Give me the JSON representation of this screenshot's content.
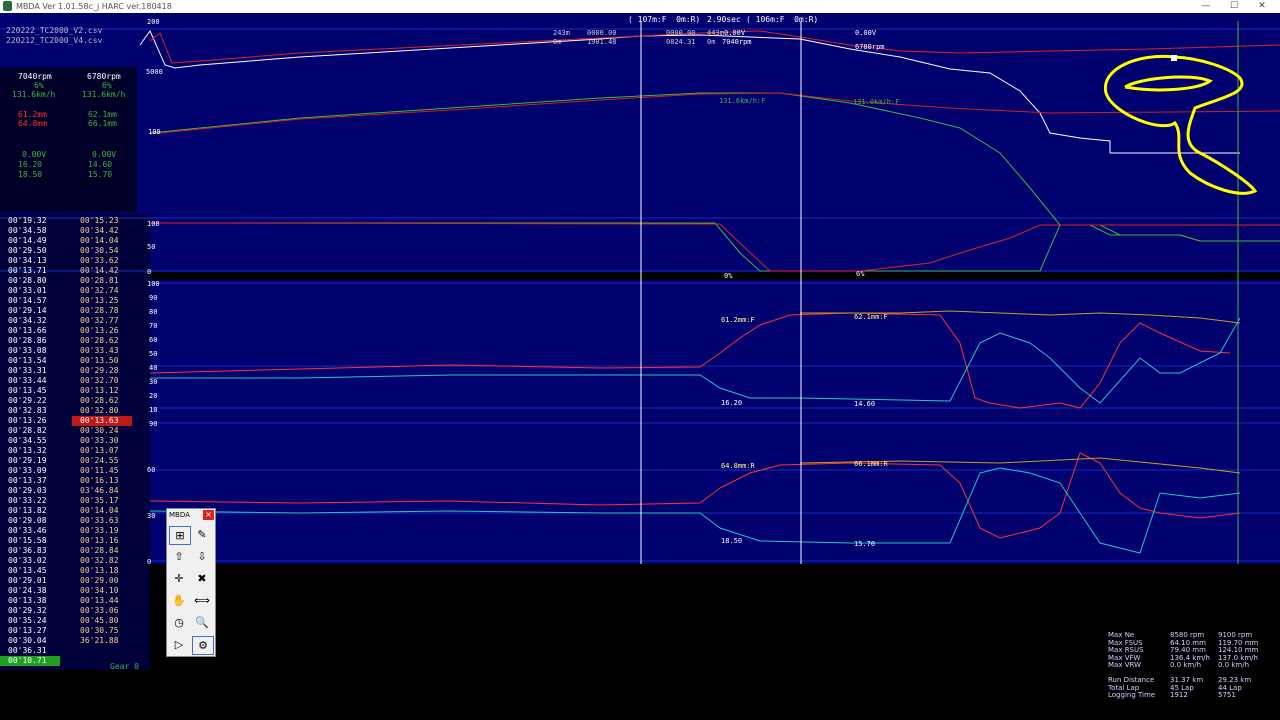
{
  "window": {
    "title": "MBDA Ver 1.01.58c_j HARC ver.180418",
    "min_icon": "—",
    "max_icon": "☐",
    "close_icon": "✕"
  },
  "files": [
    "220222_TC2000_V2.csv",
    "220212_TC2000_V4.csv"
  ],
  "top_info": {
    "range": "( 107m:F  0m:R)",
    "time": "2.90sec",
    "range2": "( 106m:F  0m:R)",
    "dist_a": "243m",
    "dist_b": "0m",
    "time_a": "0000.00",
    "time_b": "1901.48",
    "time_c": "0000.00",
    "time_d": "0824.31",
    "m_a": "443m",
    "m_b": "0m",
    "rpm_a": "7040rpm",
    "volt_a": "0.00V"
  },
  "left_readouts": {
    "col1": [
      "7040rpm",
      "6%",
      "131.6km/h",
      "61.2mm",
      "64.8mm",
      "0.00V",
      "16.20",
      "18.50"
    ],
    "col2": [
      "6780rpm",
      "6%",
      "131.6km/h",
      "62.1mm",
      "66.1mm",
      "0.00V",
      "14.60",
      "15.70"
    ]
  },
  "axis_labels": {
    "rpm_max": "200",
    "rpm_val": "5000",
    "speed": "100",
    "thr": "100",
    "thr_mid": "50",
    "thr_min": "0",
    "susp_ticks": [
      "100",
      "90",
      "80",
      "70",
      "60",
      "50",
      "40",
      "30",
      "20",
      "10"
    ],
    "susp2_ticks": [
      "90",
      "60",
      "30",
      "0"
    ]
  },
  "chart_labels": {
    "volt": "0.00V",
    "rpm": "6780rpm",
    "speed_a": "131.6km/h:F",
    "speed_b": "131.0km/h:F",
    "thr_a": "0%",
    "thr_b": "6%",
    "fs_a": "61.2mm:F",
    "fs_b": "62.1mm:F",
    "v1": "16.20",
    "v2": "14.60",
    "rs_a": "64.8mm:R",
    "rs_b": "66.1mm:R",
    "v3": "18.50",
    "v4": "15.70"
  },
  "lap_times": {
    "col1": [
      "00'19.32",
      "00'34.58",
      "00'14.49",
      "00'29.50",
      "00'34.13",
      "00'13.71",
      "00'28.80",
      "00'33.01",
      "00'14.57",
      "00'29.14",
      "00'34.32",
      "00'13.66",
      "00'28.86",
      "00'33.08",
      "00'13.54",
      "00'33.31",
      "00'33.44",
      "00'13.45",
      "00'29.22",
      "00'32.83",
      "00'13.26",
      "00'28.82",
      "00'34.55",
      "00'13.32",
      "00'29.19",
      "00'33.09",
      "00'13.37",
      "00'29.03",
      "00'33.22",
      "00'13.82",
      "00'29.08",
      "00'33.46",
      "00'15.58",
      "00'36.83",
      "00'33.02",
      "00'13.45",
      "00'29.01",
      "00'24.38",
      "00'13.38",
      "00'29.32",
      "00'35.24",
      "00'13.27",
      "00'30.04",
      "00'36.31",
      "00'10.71"
    ],
    "col2": [
      "00'15.23",
      "00'34.42",
      "00'14.04",
      "00'30.54",
      "00'33.62",
      "00'14.42",
      "00'28.81",
      "00'32.74",
      "00'13.25",
      "00'28.78",
      "00'32.77",
      "00'13.26",
      "00'28.62",
      "00'33.43",
      "00'13.50",
      "00'29.28",
      "00'32.70",
      "00'13.12",
      "00'28.62",
      "00'32.80",
      "00'13.63",
      "00'30.24",
      "00'33.30",
      "00'13.07",
      "00'24.55",
      "00'11.45",
      "00'16.13",
      "03'46.84",
      "00'35.17",
      "00'14.04",
      "00'33.63",
      "00'33.19",
      "00'13.16",
      "00'28.84",
      "00'32.82",
      "00'13.18",
      "00'29.00",
      "00'34.10",
      "00'13.44",
      "00'33.06",
      "00'45.80",
      "00'30.75",
      "36'21.88"
    ],
    "gear": "Gear 0"
  },
  "toolbar": {
    "title": "MBDA",
    "close": "×",
    "icons": [
      "measure-icon",
      "chart-icon",
      "export-icon",
      "import-icon",
      "crosshair-icon",
      "delete-icon",
      "hand-icon",
      "zoom-horizontal-icon",
      "clock-icon",
      "magnifier-icon",
      "play-icon",
      "settings-icon"
    ],
    "glyphs": [
      "⊞",
      "✎",
      "⇧",
      "⇩",
      "✛",
      "✖",
      "✋",
      "⟺",
      "◷",
      "🔍",
      "▷",
      "⚙"
    ]
  },
  "stats": {
    "labels": "Max Ne\nMax FSUS\nMax RSUS\nMax VFW\nMax VRW\n\nRun Distance\nTotal Lap\nLogging Time",
    "v1": "8580 rpm\n64.10 mm\n79.40 mm\n136.4 km/h\n0.0 km/h\n\n31.37 km\n45 Lap\n1912",
    "v2": "9100 rpm\n119.70 mm\n124.10 mm\n137.0 km/h\n0.0 km/h\n\n29.23 km\n44 Lap\n5751"
  },
  "colors": {
    "bg": "#00006e",
    "green": "#38b838",
    "red": "#ff2020",
    "cyan": "#20c0c0",
    "yellow": "#ffff00",
    "white": "#ffffff",
    "orange": "#ffb040"
  }
}
